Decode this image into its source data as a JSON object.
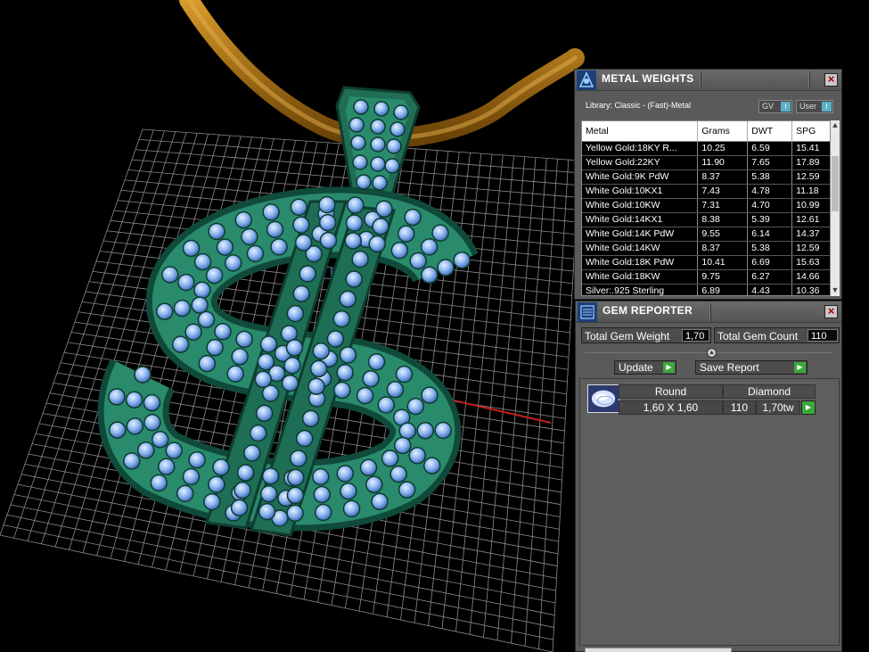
{
  "metal_weights": {
    "title": "METAL WEIGHTS",
    "library_label": "Library: Classic - (Fast)-Metal",
    "toggle_gv": "GV",
    "toggle_user": "User",
    "columns": [
      "Metal",
      "Grams",
      "DWT",
      "SPG"
    ],
    "rows": [
      [
        "Yellow Gold:18KY R...",
        "10.25",
        "6.59",
        "15.41"
      ],
      [
        "Yellow Gold:22KY",
        "11.90",
        "7.65",
        "17.89"
      ],
      [
        "White Gold:9K PdW",
        "8.37",
        "5.38",
        "12.59"
      ],
      [
        "White Gold:10KX1",
        "7.43",
        "4.78",
        "11.18"
      ],
      [
        "White Gold:10KW",
        "7.31",
        "4.70",
        "10.99"
      ],
      [
        "White Gold:14KX1",
        "8.38",
        "5.39",
        "12.61"
      ],
      [
        "White Gold:14K PdW",
        "9.55",
        "6.14",
        "14.37"
      ],
      [
        "White Gold:14KW",
        "8.37",
        "5.38",
        "12.59"
      ],
      [
        "White Gold:18K PdW",
        "10.41",
        "6.69",
        "15.63"
      ],
      [
        "White Gold:18KW",
        "9.75",
        "6.27",
        "14.66"
      ],
      [
        "Silver:.925 Sterling",
        "6.89",
        "4.43",
        "10.36"
      ]
    ]
  },
  "gem_reporter": {
    "title": "GEM REPORTER",
    "total_weight_label": "Total Gem Weight",
    "total_weight_value": "1,70",
    "total_count_label": "Total Gem Count",
    "total_count_value": "110",
    "update_label": "Update",
    "save_report_label": "Save Report",
    "gems": [
      {
        "shape": "Round",
        "material": "Diamond",
        "size": "1,60 X 1,60",
        "count": "110",
        "weight": "1,70tw"
      }
    ]
  },
  "colors": {
    "panel_bg": "#5a5a5a",
    "go_button": "#3aa83a",
    "pendant": "#2a8a6c",
    "gem": "#8ab4ee",
    "chain": "#a06a0c",
    "grid": "#9a9a9a",
    "axis_x": "#c42020"
  }
}
